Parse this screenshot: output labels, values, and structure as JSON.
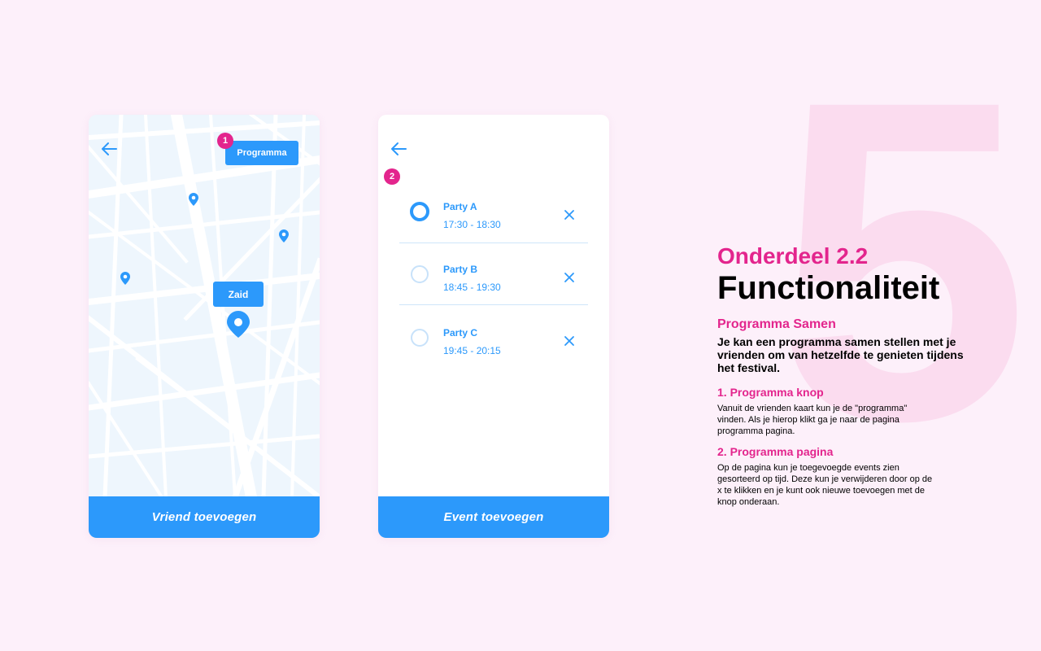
{
  "screen1": {
    "programma_button": "Programma",
    "friend_name": "Zaid",
    "bottom_button": "Vriend toevoegen",
    "badge": "1"
  },
  "screen2": {
    "badge": "2",
    "events": [
      {
        "name": "Party A",
        "time": "17:30 - 18:30",
        "selected": true
      },
      {
        "name": "Party B",
        "time": "18:45 - 19:30",
        "selected": false
      },
      {
        "name": "Party C",
        "time": "19:45 - 20:15",
        "selected": false
      }
    ],
    "bottom_button": "Event toevoegen"
  },
  "info": {
    "section_number": "5",
    "section_label": "Onderdeel 2.2",
    "title": "Functionaliteit",
    "subtitle": "Programma Samen",
    "intro": "Je kan een programma samen stellen met je vrienden om van hetzelfde te genieten tijdens het festival.",
    "items": [
      {
        "title": "1. Programma knop",
        "text": "Vanuit de vrienden kaart kun je de \"programma\" vinden. Als je hierop klikt ga je naar de pagina programma pagina."
      },
      {
        "title": "2. Programma pagina",
        "text": "Op de pagina kun je toegevoegde events zien gesorteerd op tijd. Deze kun je verwijderen door op de x te klikken en je kunt ook nieuwe toevoegen met de knop onderaan."
      }
    ]
  },
  "colors": {
    "accent_blue": "#2c99fb",
    "accent_pink": "#e3258d",
    "background": "#fdf0fa",
    "map_base": "#eef6fd"
  }
}
